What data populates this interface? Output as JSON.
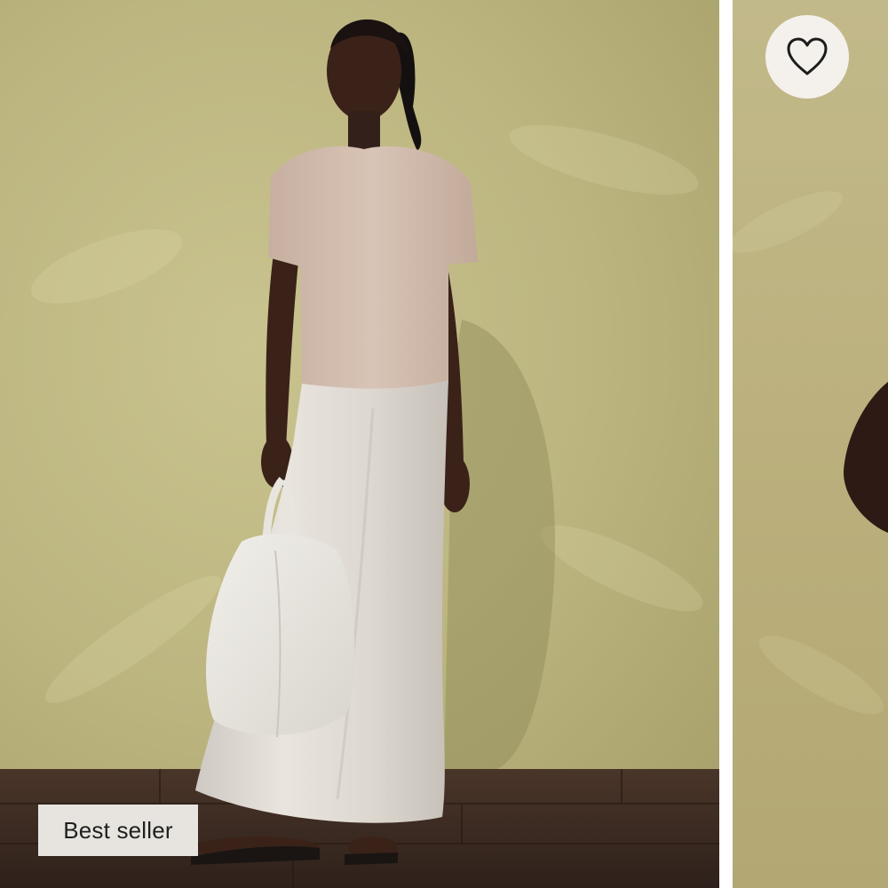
{
  "product_card": {
    "badge_label": "Best seller",
    "favorite_icon": "heart-outline-icon"
  },
  "colors": {
    "wall": "#bdb782",
    "floor": "#3a2a22",
    "badge_bg": "#eeece8",
    "badge_text": "#1f1f1f",
    "favorite_bg": "#f4f1ec"
  }
}
